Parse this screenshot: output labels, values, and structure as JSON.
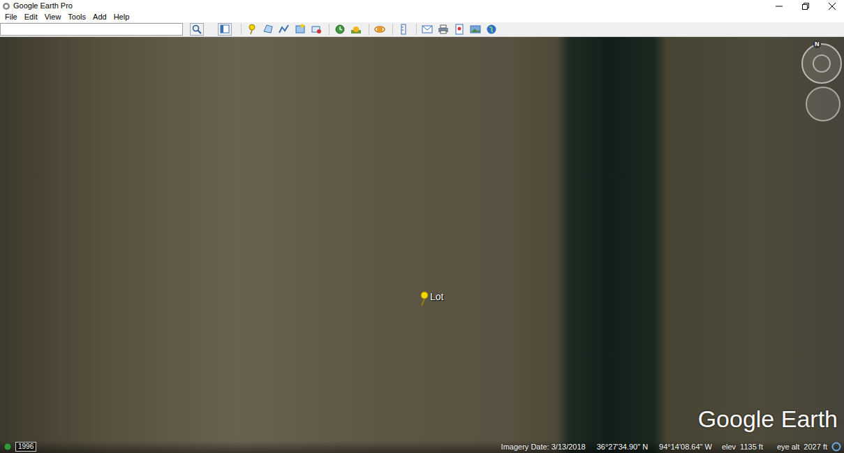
{
  "window": {
    "title": "Google Earth Pro"
  },
  "menu": [
    {
      "label": "File"
    },
    {
      "label": "Edit"
    },
    {
      "label": "View"
    },
    {
      "label": "Tools"
    },
    {
      "label": "Add"
    },
    {
      "label": "Help"
    }
  ],
  "search": {
    "value": ""
  },
  "map": {
    "placemark": {
      "label": "Lot"
    },
    "watermark": "Google Earth",
    "compass": "N"
  },
  "status_bar": {
    "year": "1996",
    "imagery_date": "Imagery Date: 3/13/2018",
    "lat": "36°27'34.90\" N",
    "lon": "94°14'08.64\" W",
    "elev_label": "elev",
    "elev": "1135 ft",
    "eye_alt_label": "eye alt",
    "eye_alt": "2027 ft"
  }
}
